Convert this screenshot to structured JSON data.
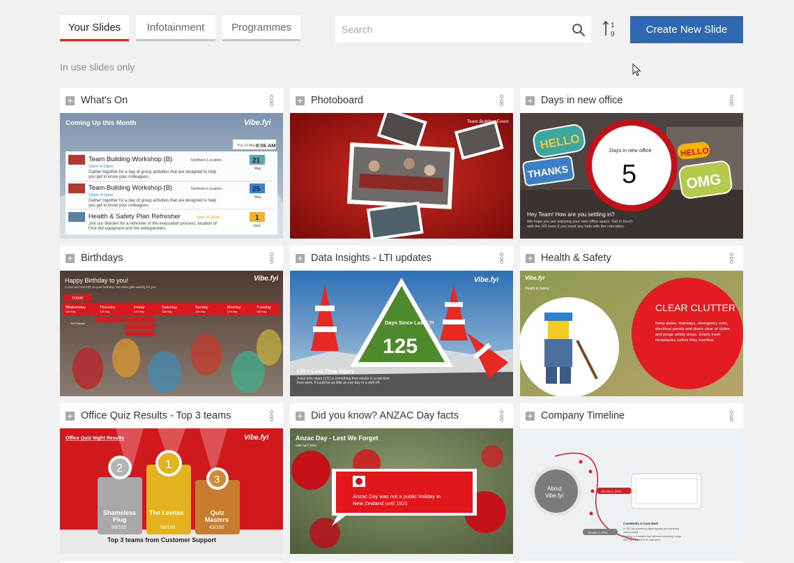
{
  "tabs": [
    {
      "label": "Your Slides",
      "active": true
    },
    {
      "label": "Infotainment",
      "active": false
    },
    {
      "label": "Programmes",
      "active": false
    }
  ],
  "search": {
    "placeholder": "Search",
    "value": ""
  },
  "sort_icon": "sort-numeric-icon",
  "create_button": {
    "label": "Create New Slide"
  },
  "filter_note": "In use slides only",
  "colors": {
    "accent_red": "#d9251d",
    "primary_blue": "#2d68b0",
    "background": "#f1f1f1"
  },
  "cards": [
    {
      "title": "What's On",
      "thumb": {
        "heading": "Coming Up this Month",
        "logo": "Vibe.fyi",
        "date": "Thu 13 May",
        "time": "8:06 AM",
        "events": [
          {
            "title": "Team Building Workshop (B)",
            "location": "Northern Location.",
            "time": "12pm–4:15pm",
            "desc1": "Gather together for a day of group activities that are designed to help",
            "desc2": "you get to know your colleagues.",
            "day": "21",
            "month": "May"
          },
          {
            "title": "Team Building Workshop (B)",
            "location": "Northern Location.",
            "time": "12pm–4:15pm",
            "desc1": "Gather together for a day of group activities that are designed to help",
            "desc2": "you get to know your colleagues.",
            "day": "25",
            "month": "May"
          },
          {
            "title": "Health & Safety Plan Refresher",
            "location": "",
            "time": "9am–9:15am",
            "desc1": "Join our Warden for a refresher of the evacuation process, location of",
            "desc2": "First Aid equipment and fire extinguishers.",
            "day": "1",
            "month": "June"
          }
        ]
      }
    },
    {
      "title": "Photoboard",
      "thumb": {
        "label": "Team Building Event"
      }
    },
    {
      "title": "Days in new office",
      "thumb": {
        "caption": "Days in new office",
        "number": "5",
        "greeting": "Hey Team! How are you settling in?",
        "sub1": "We hope you are enjoying your new office space. Get in touch",
        "sub2": "with the HR team if you need any help with the relocation.",
        "stickers": [
          "HELLO",
          "THANKS",
          "HELLO",
          "OMG"
        ]
      }
    },
    {
      "title": "Birthdays",
      "thumb": {
        "heading": "Happy Birthday to you!",
        "sub": "Come and visit HR on your birthday. We have gifts waiting for you",
        "logo": "Vibe.fyi",
        "today": "TODAY",
        "days": [
          {
            "d": "Wednesday",
            "n": "12th May"
          },
          {
            "d": "Thursday",
            "n": "13th May"
          },
          {
            "d": "Friday",
            "n": "14th May"
          },
          {
            "d": "Saturday",
            "n": "15th May"
          },
          {
            "d": "Sunday",
            "n": "16th May"
          },
          {
            "d": "Monday",
            "n": "17th May"
          },
          {
            "d": "Tuesday",
            "n": "18th May"
          }
        ],
        "name": "Pat Example"
      }
    },
    {
      "title": "Data Insights - LTI updates",
      "thumb": {
        "logo": "Vibe.fyi",
        "caption": "Days Since Last LTI",
        "number": "125",
        "footer": "LTI = Lost Time Injury",
        "sub1": "A lost time injury (LTI) is something that results in a lost time",
        "sub2": "from work. It could be as little as one day or a shift off."
      }
    },
    {
      "title": "Health & Safety",
      "thumb": {
        "logo": "Vibe.fyi",
        "tag": "Health & Safety",
        "heading": "CLEAR CLUTTER",
        "body1": "Keep aisles, stairways, emergency exits,",
        "body2": "electrical panels and doors clear of clutter,",
        "body3": "and purge untidy areas. Empty trash",
        "body4": "receptacles before they overflow."
      }
    },
    {
      "title": "Office Quiz Results - Top 3 teams",
      "thumb": {
        "heading": "Office Quiz Night Results",
        "logo": "Vibe.fyi",
        "places": [
          {
            "rank": "2",
            "name1": "Shameless",
            "name2": "Plug",
            "score": "89/100"
          },
          {
            "rank": "1",
            "name1": "The Levites",
            "name2": "",
            "score": "98/100"
          },
          {
            "rank": "3",
            "name1": "Quiz",
            "name2": "Masters",
            "score": "43/100"
          }
        ],
        "footer": "Top 3 teams from Customer Support"
      }
    },
    {
      "title": "Did you know? ANZAC Day facts",
      "thumb": {
        "heading": "Anzac Day - Lest We Forget",
        "date": "25th April 2021",
        "fact1": "Anzac Day was not a public holiday in",
        "fact2": "New Zealand until 1921"
      }
    },
    {
      "title": "Company Timeline",
      "thumb": {
        "hub1": "About",
        "hub2": "Vibe.fyi",
        "date1": "January 1, 2020",
        "date2": "January 1, 2015",
        "note": "CoInMedia is launched!",
        "n1": "In 2013 we pioneered digital signage and streaming",
        "n2": "visual content.",
        "n3": "Evolving to a solution that delivered streaming, image",
        "n4": "and video content to its customers."
      }
    }
  ]
}
